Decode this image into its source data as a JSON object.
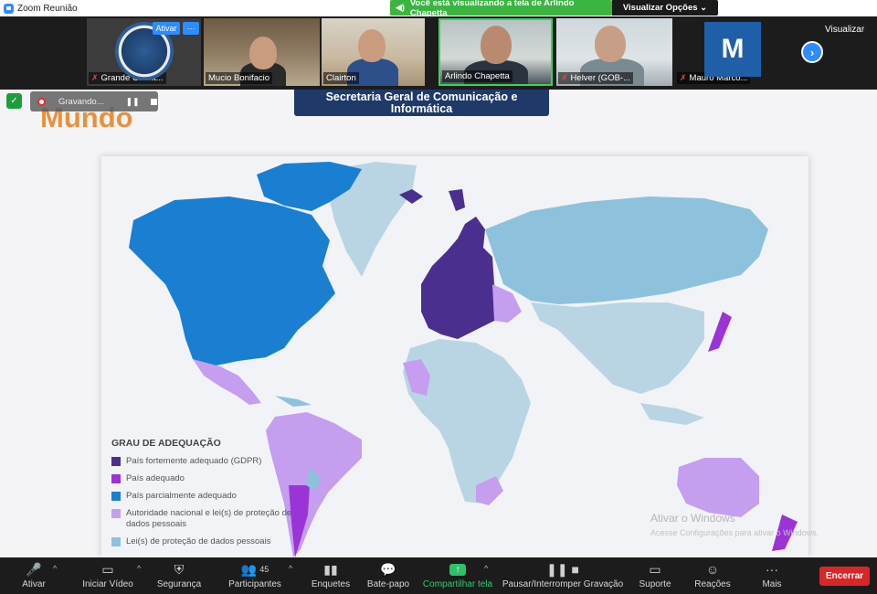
{
  "window": {
    "title": "Zoom Reunião"
  },
  "share_notice": {
    "text": "Você está visualizando a tela de Arlindo Chapetta",
    "options_label": "Visualizar Opções ⌄"
  },
  "participants_strip": {
    "ativar_label": "Ativar",
    "more_label": "···",
    "view_label": "Visualizar",
    "tiles": [
      {
        "name": "Grande Orient...",
        "muted": true
      },
      {
        "name": "Mucio Bonifacio",
        "muted": false
      },
      {
        "name": "Clairton",
        "muted": false
      },
      {
        "name": "Arlindo Chapetta",
        "muted": false
      },
      {
        "name": "Helver (GOB-...",
        "muted": true
      },
      {
        "name": "Mauro Marco...",
        "muted": true,
        "avatar_letter": "M"
      }
    ]
  },
  "recording": {
    "label": "Gravando..."
  },
  "slide": {
    "banner": "Secretaria Geral de Comunicação e Informática",
    "heading": "Mundo",
    "legend_title": "GRAU DE ADEQUAÇÃO",
    "legend_items": [
      {
        "label": "País fortemente adequado (GDPR)",
        "color": "#4b2f8f"
      },
      {
        "label": "País adequado",
        "color": "#9b34d6"
      },
      {
        "label": "País parcialmente adequado",
        "color": "#1a7fd1"
      },
      {
        "label": "Autoridade nacional e lei(s) de proteção de dados pessoais",
        "color": "#c59ef0"
      },
      {
        "label": "Lei(s) de proteção de dados pessoais",
        "color": "#8ec2dc"
      }
    ],
    "watermark_title": "Ativar o Windows",
    "watermark_sub": "Acesse Configurações para ativar o Windows."
  },
  "toolbar": {
    "items": [
      {
        "label": "Ativar",
        "icon": "mic-muted-icon"
      },
      {
        "label": "Iniciar Vídeo",
        "icon": "video-off-icon"
      },
      {
        "label": "Segurança",
        "icon": "shield-icon"
      },
      {
        "label": "Participantes",
        "icon": "people-icon",
        "count": "45"
      },
      {
        "label": "Enquetes",
        "icon": "poll-icon"
      },
      {
        "label": "Bate-papo",
        "icon": "chat-icon"
      },
      {
        "label": "Compartilhar tela",
        "icon": "share-screen-icon"
      },
      {
        "label": "Pausar/Interromper Gravação",
        "icon": "pause-stop-icon"
      },
      {
        "label": "Suporte",
        "icon": "support-icon"
      },
      {
        "label": "Reações",
        "icon": "reaction-icon"
      },
      {
        "label": "Mais",
        "icon": "more-icon"
      }
    ],
    "end_label": "Encerrar"
  },
  "colors": {
    "zoom_blue": "#2d8cff",
    "share_green": "#3bb540",
    "end_red": "#d9262a",
    "heading_orange": "#e9913a",
    "banner_navy": "#1f3a68"
  }
}
